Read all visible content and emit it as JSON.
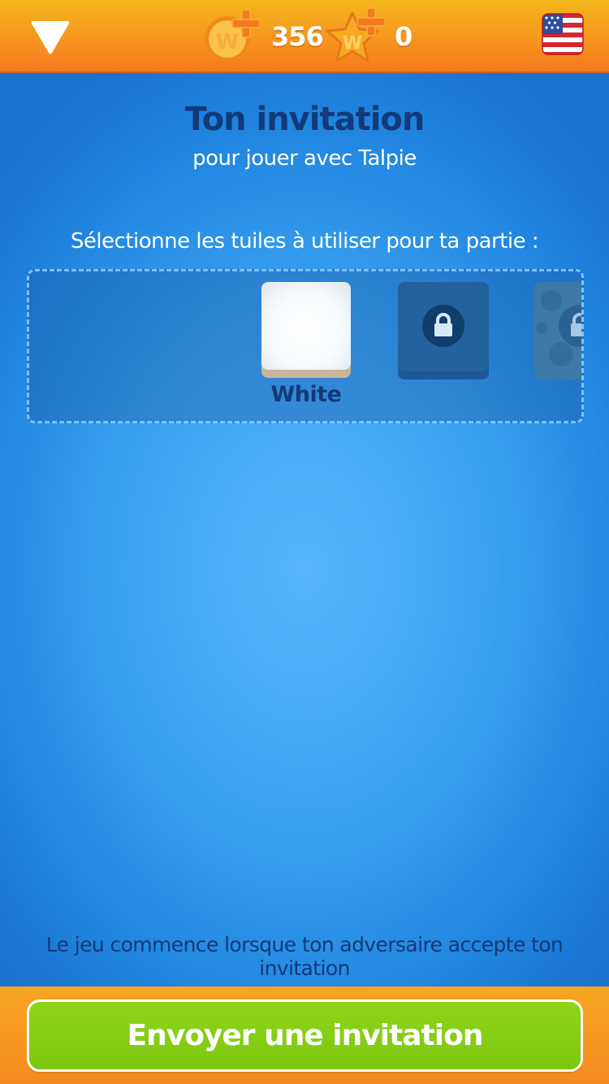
{
  "header": {
    "coins": "356",
    "stars": "0",
    "coin_glyph": "W",
    "star_glyph": "W",
    "language_icon": "us-flag-icon",
    "menu_icon": "dropdown-triangle-icon"
  },
  "invitation": {
    "title": "Ton invitation",
    "subtitle": "pour jouer avec Talpie",
    "select_label": "Sélectionne les tuiles à utiliser pour ta partie :"
  },
  "tiles": {
    "items": [
      {
        "label": "White",
        "state": "selected"
      },
      {
        "label": "",
        "state": "locked"
      },
      {
        "label": "",
        "state": "locked"
      }
    ]
  },
  "footer": {
    "note": "Le jeu commence lorsque ton adversaire accepte ton invitation",
    "send_label": "Envoyer une invitation"
  },
  "colors": {
    "accent_orange": "#f7921f",
    "background_blue": "#3aa2f2",
    "title_navy": "#123a78",
    "button_green": "#85cc14"
  }
}
